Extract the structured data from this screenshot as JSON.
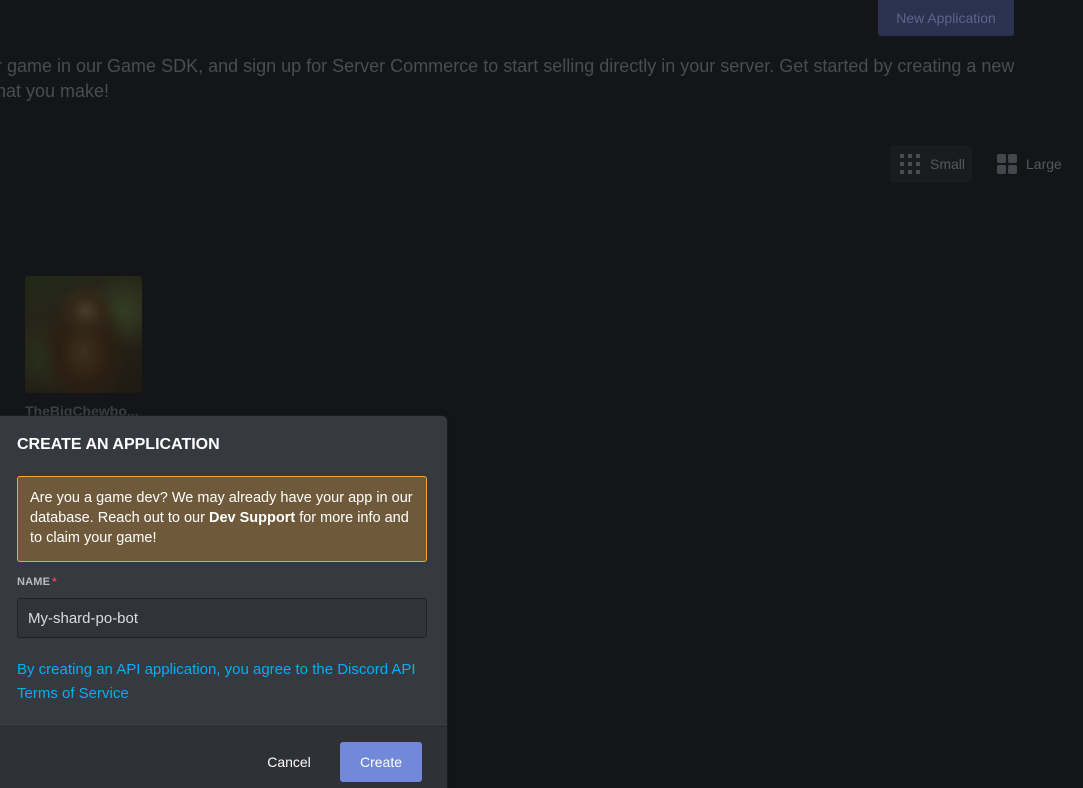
{
  "header": {
    "new_application_label": "New Application"
  },
  "intro": {
    "line1": "r game in our Game SDK, and sign up for Server Commerce to start selling directly in your server. Get started by creating a new",
    "line2": "hat you make!"
  },
  "view_toggle": {
    "small_label": "Small",
    "large_label": "Large",
    "selected": "Small"
  },
  "applications": [
    {
      "name": "TheBigChewbo..."
    }
  ],
  "modal": {
    "title": "CREATE AN APPLICATION",
    "warning": {
      "text_before": "Are you a game dev? We may already have your app in our database. Reach out to our ",
      "link_text": "Dev Support",
      "text_after": " for more info and to claim your game!",
      "border_color": "#faa61a"
    },
    "name_label": "NAME",
    "required_marker": "*",
    "name_value": "My-shard-po-bot",
    "tos_text": "By creating an API application, you agree to the Discord API Terms of Service",
    "cancel_label": "Cancel",
    "create_label": "Create",
    "accent_color": "#7289da",
    "link_color": "#00b0f4"
  }
}
